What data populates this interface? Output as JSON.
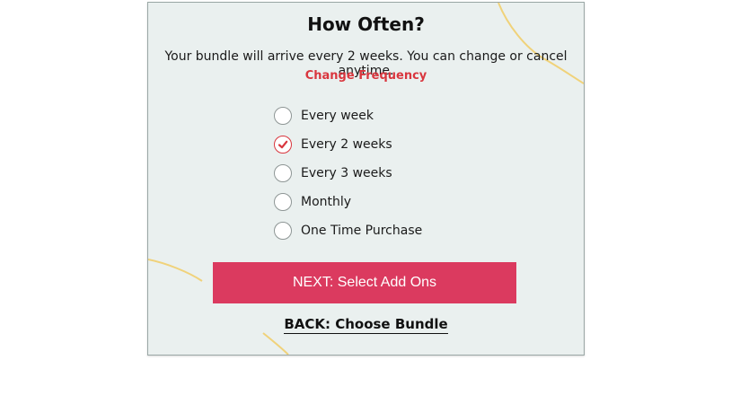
{
  "frequency": {
    "title": "How Often?",
    "subtitle": "Your bundle will arrive every 2 weeks. You can change or cancel anytime.",
    "change_link": "Change Frequency",
    "options": [
      {
        "label": "Every week",
        "selected": false
      },
      {
        "label": "Every 2 weeks",
        "selected": true
      },
      {
        "label": "Every 3 weeks",
        "selected": false
      },
      {
        "label": "Monthly",
        "selected": false
      },
      {
        "label": "One Time Purchase",
        "selected": false
      }
    ],
    "next_button": "NEXT: Select Add Ons",
    "back_link": "BACK: Choose Bundle"
  },
  "colors": {
    "accent_red": "#d9363e",
    "button_pink": "#db3a5f",
    "panel_bg": "#eaf0ef",
    "decor_line": "#f0d27a"
  },
  "icons": {
    "selected_check": "check-icon"
  }
}
